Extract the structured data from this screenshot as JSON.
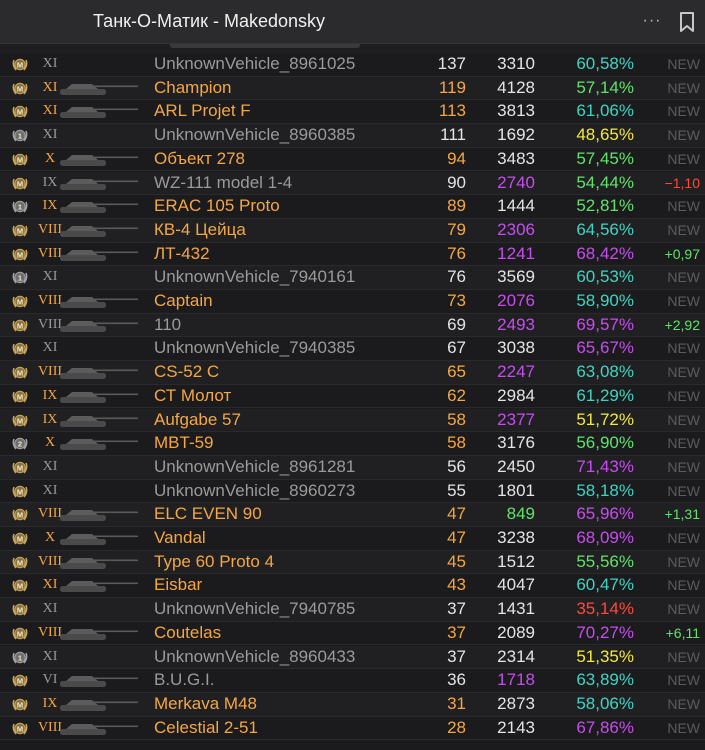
{
  "window": {
    "title": "Танк-О-Матик - Makedonsky",
    "more_label": "···"
  },
  "colors": {
    "orange": "#f5a742",
    "purple": "#c74cf0",
    "teal": "#3fd4c2",
    "green": "#5fe36a",
    "yellow": "#f2ea3a",
    "red": "#ff4a3a",
    "new_gray": "#5b5b5e"
  },
  "rows": [
    {
      "medal": "M",
      "tier": "XI",
      "tier_color": "gray",
      "has_img": false,
      "name": "UnknownVehicle_8961025",
      "name_color": "gray",
      "battles": "137",
      "battles_color": "white",
      "dmg": "3310",
      "dmg_color": "white",
      "wr": "60,58%",
      "wr_color": "teal",
      "delta": "NEW",
      "delta_type": "new"
    },
    {
      "medal": "M",
      "tier": "XI",
      "tier_color": "orange",
      "has_img": true,
      "name": "Champion",
      "name_color": "orange",
      "battles": "119",
      "battles_color": "orange",
      "dmg": "4128",
      "dmg_color": "white",
      "wr": "57,14%",
      "wr_color": "green",
      "delta": "NEW",
      "delta_type": "new"
    },
    {
      "medal": "M",
      "tier": "XI",
      "tier_color": "orange",
      "has_img": true,
      "name": "ARL Projet F",
      "name_color": "orange",
      "battles": "113",
      "battles_color": "orange",
      "dmg": "3813",
      "dmg_color": "white",
      "wr": "61,06%",
      "wr_color": "teal",
      "delta": "NEW",
      "delta_type": "new"
    },
    {
      "medal": "1",
      "tier": "XI",
      "tier_color": "gray",
      "has_img": false,
      "name": "UnknownVehicle_8960385",
      "name_color": "gray",
      "battles": "111",
      "battles_color": "white",
      "dmg": "1692",
      "dmg_color": "white",
      "wr": "48,65%",
      "wr_color": "yellow",
      "delta": "NEW",
      "delta_type": "new"
    },
    {
      "medal": "M",
      "tier": "X",
      "tier_color": "orange",
      "has_img": true,
      "name": "Объект 278",
      "name_color": "orange",
      "battles": "94",
      "battles_color": "orange",
      "dmg": "3483",
      "dmg_color": "white",
      "wr": "57,45%",
      "wr_color": "green",
      "delta": "NEW",
      "delta_type": "new"
    },
    {
      "medal": "M",
      "tier": "IX",
      "tier_color": "gray",
      "has_img": true,
      "name": "WZ-111 model 1-4",
      "name_color": "gray",
      "battles": "90",
      "battles_color": "white",
      "dmg": "2740",
      "dmg_color": "purple",
      "wr": "54,44%",
      "wr_color": "green",
      "delta": "−1,10",
      "delta_type": "neg"
    },
    {
      "medal": "1",
      "tier": "IX",
      "tier_color": "orange",
      "has_img": true,
      "name": "ERAC 105 Proto",
      "name_color": "orange",
      "battles": "89",
      "battles_color": "orange",
      "dmg": "1444",
      "dmg_color": "white",
      "wr": "52,81%",
      "wr_color": "green",
      "delta": "NEW",
      "delta_type": "new"
    },
    {
      "medal": "M",
      "tier": "VIII",
      "tier_color": "orange",
      "has_img": true,
      "name": "КВ-4 Цейца",
      "name_color": "orange",
      "battles": "79",
      "battles_color": "orange",
      "dmg": "2306",
      "dmg_color": "purple",
      "wr": "64,56%",
      "wr_color": "teal",
      "delta": "NEW",
      "delta_type": "new"
    },
    {
      "medal": "M",
      "tier": "VIII",
      "tier_color": "orange",
      "has_img": true,
      "name": "ЛТ-432",
      "name_color": "orange",
      "battles": "76",
      "battles_color": "orange",
      "dmg": "1241",
      "dmg_color": "purple",
      "wr": "68,42%",
      "wr_color": "purple",
      "delta": "+0,97",
      "delta_type": "pos"
    },
    {
      "medal": "1",
      "tier": "XI",
      "tier_color": "gray",
      "has_img": false,
      "name": "UnknownVehicle_7940161",
      "name_color": "gray",
      "battles": "76",
      "battles_color": "white",
      "dmg": "3569",
      "dmg_color": "white",
      "wr": "60,53%",
      "wr_color": "teal",
      "delta": "NEW",
      "delta_type": "new"
    },
    {
      "medal": "M",
      "tier": "VIII",
      "tier_color": "orange",
      "has_img": true,
      "name": "Captain",
      "name_color": "orange",
      "battles": "73",
      "battles_color": "orange",
      "dmg": "2076",
      "dmg_color": "purple",
      "wr": "58,90%",
      "wr_color": "teal",
      "delta": "NEW",
      "delta_type": "new"
    },
    {
      "medal": "M",
      "tier": "VIII",
      "tier_color": "gray",
      "has_img": true,
      "name": "110",
      "name_color": "gray",
      "battles": "69",
      "battles_color": "white",
      "dmg": "2493",
      "dmg_color": "purple",
      "wr": "69,57%",
      "wr_color": "purple",
      "delta": "+2,92",
      "delta_type": "pos"
    },
    {
      "medal": "M",
      "tier": "XI",
      "tier_color": "gray",
      "has_img": false,
      "name": "UnknownVehicle_7940385",
      "name_color": "gray",
      "battles": "67",
      "battles_color": "white",
      "dmg": "3038",
      "dmg_color": "white",
      "wr": "65,67%",
      "wr_color": "purple",
      "delta": "NEW",
      "delta_type": "new"
    },
    {
      "medal": "M",
      "tier": "VIII",
      "tier_color": "orange",
      "has_img": true,
      "name": "CS-52 C",
      "name_color": "orange",
      "battles": "65",
      "battles_color": "orange",
      "dmg": "2247",
      "dmg_color": "purple",
      "wr": "63,08%",
      "wr_color": "teal",
      "delta": "NEW",
      "delta_type": "new"
    },
    {
      "medal": "M",
      "tier": "IX",
      "tier_color": "orange",
      "has_img": true,
      "name": "СТ Молот",
      "name_color": "orange",
      "battles": "62",
      "battles_color": "orange",
      "dmg": "2984",
      "dmg_color": "white",
      "wr": "61,29%",
      "wr_color": "teal",
      "delta": "NEW",
      "delta_type": "new"
    },
    {
      "medal": "M",
      "tier": "IX",
      "tier_color": "orange",
      "has_img": true,
      "name": "Aufgabe 57",
      "name_color": "orange",
      "battles": "58",
      "battles_color": "orange",
      "dmg": "2377",
      "dmg_color": "purple",
      "wr": "51,72%",
      "wr_color": "yellow",
      "delta": "NEW",
      "delta_type": "new"
    },
    {
      "medal": "2",
      "tier": "X",
      "tier_color": "orange",
      "has_img": true,
      "name": "MBT-59",
      "name_color": "orange",
      "battles": "58",
      "battles_color": "orange",
      "dmg": "3176",
      "dmg_color": "white",
      "wr": "56,90%",
      "wr_color": "green",
      "delta": "NEW",
      "delta_type": "new"
    },
    {
      "medal": "M",
      "tier": "XI",
      "tier_color": "gray",
      "has_img": false,
      "name": "UnknownVehicle_8961281",
      "name_color": "gray",
      "battles": "56",
      "battles_color": "white",
      "dmg": "2450",
      "dmg_color": "white",
      "wr": "71,43%",
      "wr_color": "purple",
      "delta": "NEW",
      "delta_type": "new"
    },
    {
      "medal": "M",
      "tier": "XI",
      "tier_color": "gray",
      "has_img": false,
      "name": "UnknownVehicle_8960273",
      "name_color": "gray",
      "battles": "55",
      "battles_color": "white",
      "dmg": "1801",
      "dmg_color": "white",
      "wr": "58,18%",
      "wr_color": "teal",
      "delta": "NEW",
      "delta_type": "new"
    },
    {
      "medal": "M",
      "tier": "VIII",
      "tier_color": "orange",
      "has_img": true,
      "name": "ELC EVEN 90",
      "name_color": "orange",
      "battles": "47",
      "battles_color": "orange",
      "dmg": "849",
      "dmg_color": "green",
      "wr": "65,96%",
      "wr_color": "purple",
      "delta": "+1,31",
      "delta_type": "pos"
    },
    {
      "medal": "M",
      "tier": "X",
      "tier_color": "orange",
      "has_img": true,
      "name": "Vandal",
      "name_color": "orange",
      "battles": "47",
      "battles_color": "orange",
      "dmg": "3238",
      "dmg_color": "white",
      "wr": "68,09%",
      "wr_color": "purple",
      "delta": "NEW",
      "delta_type": "new"
    },
    {
      "medal": "M",
      "tier": "VIII",
      "tier_color": "orange",
      "has_img": true,
      "name": "Type 60 Proto 4",
      "name_color": "orange",
      "battles": "45",
      "battles_color": "orange",
      "dmg": "1512",
      "dmg_color": "white",
      "wr": "55,56%",
      "wr_color": "green",
      "delta": "NEW",
      "delta_type": "new"
    },
    {
      "medal": "M",
      "tier": "XI",
      "tier_color": "orange",
      "has_img": true,
      "name": "Eisbar",
      "name_color": "orange",
      "battles": "43",
      "battles_color": "orange",
      "dmg": "4047",
      "dmg_color": "white",
      "wr": "60,47%",
      "wr_color": "teal",
      "delta": "NEW",
      "delta_type": "new"
    },
    {
      "medal": "M",
      "tier": "XI",
      "tier_color": "gray",
      "has_img": false,
      "name": "UnknownVehicle_7940785",
      "name_color": "gray",
      "battles": "37",
      "battles_color": "white",
      "dmg": "1431",
      "dmg_color": "white",
      "wr": "35,14%",
      "wr_color": "red",
      "delta": "NEW",
      "delta_type": "new"
    },
    {
      "medal": "M",
      "tier": "VIII",
      "tier_color": "orange",
      "has_img": true,
      "name": "Coutelas",
      "name_color": "orange",
      "battles": "37",
      "battles_color": "orange",
      "dmg": "2089",
      "dmg_color": "white",
      "wr": "70,27%",
      "wr_color": "purple",
      "delta": "+6,11",
      "delta_type": "pos"
    },
    {
      "medal": "1",
      "tier": "XI",
      "tier_color": "gray",
      "has_img": false,
      "name": "UnknownVehicle_8960433",
      "name_color": "gray",
      "battles": "37",
      "battles_color": "white",
      "dmg": "2314",
      "dmg_color": "white",
      "wr": "51,35%",
      "wr_color": "yellow",
      "delta": "NEW",
      "delta_type": "new"
    },
    {
      "medal": "M",
      "tier": "VI",
      "tier_color": "gray",
      "has_img": true,
      "name": "B.U.G.I.",
      "name_color": "gray",
      "battles": "36",
      "battles_color": "white",
      "dmg": "1718",
      "dmg_color": "purple",
      "wr": "63,89%",
      "wr_color": "teal",
      "delta": "NEW",
      "delta_type": "new"
    },
    {
      "medal": "M",
      "tier": "IX",
      "tier_color": "orange",
      "has_img": true,
      "name": "Merkava M48",
      "name_color": "orange",
      "battles": "31",
      "battles_color": "orange",
      "dmg": "2873",
      "dmg_color": "white",
      "wr": "58,06%",
      "wr_color": "teal",
      "delta": "NEW",
      "delta_type": "new"
    },
    {
      "medal": "M",
      "tier": "VIII",
      "tier_color": "orange",
      "has_img": true,
      "name": "Celestial 2-51",
      "name_color": "orange",
      "battles": "28",
      "battles_color": "orange",
      "dmg": "2143",
      "dmg_color": "white",
      "wr": "67,86%",
      "wr_color": "purple",
      "delta": "NEW",
      "delta_type": "new"
    }
  ]
}
